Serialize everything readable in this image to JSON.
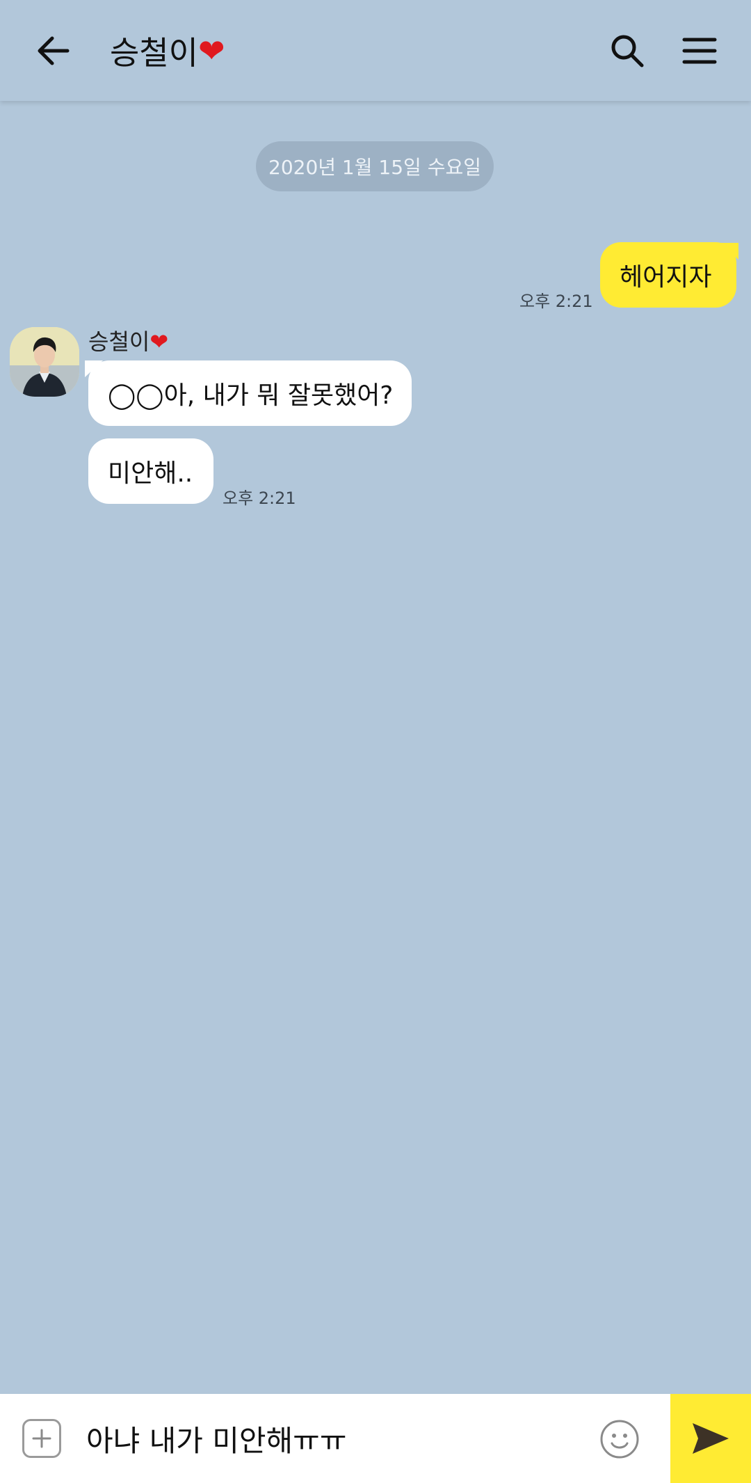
{
  "header": {
    "title": "승철이",
    "title_heart": "❤",
    "back_icon": "arrow-left-icon",
    "search_icon": "search-icon",
    "menu_icon": "hamburger-menu-icon"
  },
  "chat": {
    "date_divider": "2020년 1월 15일 수요일",
    "messages": [
      {
        "from": "me",
        "text": "헤어지자",
        "time": "오후 2:21"
      },
      {
        "from": "them",
        "text": "◯◯아, 내가 뭐 잘못했어?"
      },
      {
        "from": "them",
        "text": "미안해..",
        "time": "오후 2:21"
      }
    ],
    "sender": {
      "name": "승철이",
      "heart": "❤"
    }
  },
  "input_bar": {
    "value": "아냐 내가 미안해ㅠㅠ",
    "plus_icon": "plus-icon",
    "emoji_icon": "emoji-icon",
    "send_icon": "send-icon"
  },
  "colors": {
    "background": "#b2c7da",
    "my_bubble": "#ffeb33",
    "their_bubble": "#ffffff",
    "send_button": "#ffeb33"
  }
}
